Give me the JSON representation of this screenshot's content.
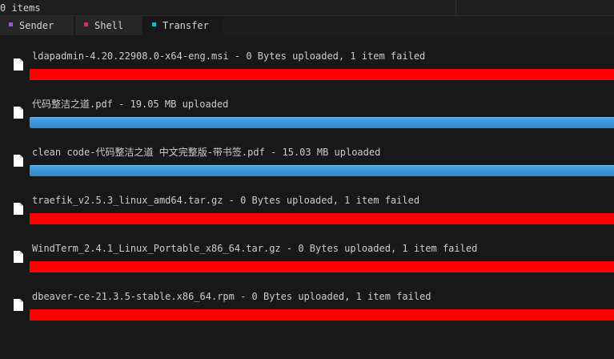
{
  "status": {
    "text": "0 items"
  },
  "tabs": [
    {
      "label": "Sender",
      "color": "#9b59d0",
      "active": false
    },
    {
      "label": "Shell",
      "color": "#e0247a",
      "active": false
    },
    {
      "label": "Transfer",
      "color": "#1fb6c9",
      "active": true
    }
  ],
  "transfers": [
    {
      "name": "ldapadmin-4.20.22908.0-x64-eng.msi",
      "status_text": " - 0 Bytes uploaded, 1 item failed",
      "state": "failed",
      "progress": 1.0
    },
    {
      "name": "代码整洁之道.pdf",
      "status_text": " - 19.05 MB uploaded",
      "state": "success",
      "progress": 1.0
    },
    {
      "name": "clean code-代码整洁之道 中文完整版-带书签.pdf",
      "status_text": " - 15.03 MB uploaded",
      "state": "success",
      "progress": 1.0
    },
    {
      "name": "traefik_v2.5.3_linux_amd64.tar.gz",
      "status_text": " - 0 Bytes uploaded, 1 item failed",
      "state": "failed",
      "progress": 1.0
    },
    {
      "name": "WindTerm_2.4.1_Linux_Portable_x86_64.tar.gz",
      "status_text": " - 0 Bytes uploaded, 1 item failed",
      "state": "failed",
      "progress": 1.0
    },
    {
      "name": "dbeaver-ce-21.3.5-stable.x86_64.rpm",
      "status_text": " - 0 Bytes uploaded, 1 item failed",
      "state": "failed",
      "progress": 1.0
    }
  ],
  "colors": {
    "failed": "#ff0000",
    "success": "#3a95dc"
  },
  "icons": {
    "file": "file-icon"
  }
}
